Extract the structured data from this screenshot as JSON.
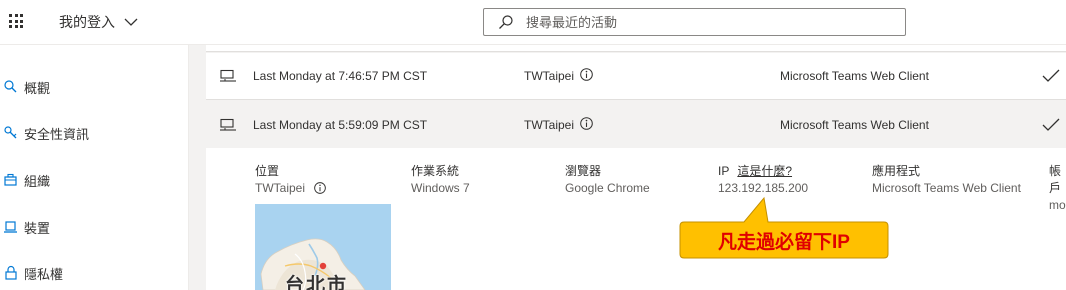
{
  "header": {
    "account_menu_label": "我的登入",
    "search_placeholder": "搜尋最近的活動"
  },
  "sidebar": {
    "items": [
      {
        "label": "概觀",
        "icon": "search-icon"
      },
      {
        "label": "安全性資訊",
        "icon": "key-icon"
      },
      {
        "label": "組織",
        "icon": "briefcase-icon"
      },
      {
        "label": "裝置",
        "icon": "laptop-icon"
      },
      {
        "label": "隱私權",
        "icon": "lock-icon"
      }
    ]
  },
  "activity": {
    "rows": [
      {
        "time": "Last Monday at 7:46:57 PM CST",
        "location": "TWTaipei",
        "app": "Microsoft Teams Web Client",
        "device_icon": "desktop-icon",
        "status_icon": "checkmark-icon"
      },
      {
        "time": "Last Monday at 5:59:09 PM CST",
        "location": "TWTaipei",
        "app": "Microsoft Teams Web Client",
        "device_icon": "desktop-icon",
        "status_icon": "checkmark-icon"
      }
    ],
    "details": {
      "location_label": "位置",
      "location_value": "TWTaipei",
      "os_label": "作業系統",
      "os_value": "Windows 7",
      "browser_label": "瀏覽器",
      "browser_value": "Google Chrome",
      "ip_label": "IP",
      "ip_link": "這是什麼?",
      "ip_value": "123.192.185.200",
      "app_label": "應用程式",
      "app_value": "Microsoft Teams Web Client",
      "account_label_partial": "帳戶",
      "account_value_partial": "mo"
    },
    "map": {
      "city_label": "台北市"
    }
  },
  "annotation": {
    "callout_text": "凡走過必留下IP",
    "callout_fill": "#ffc000",
    "callout_text_color": "#e00000"
  }
}
